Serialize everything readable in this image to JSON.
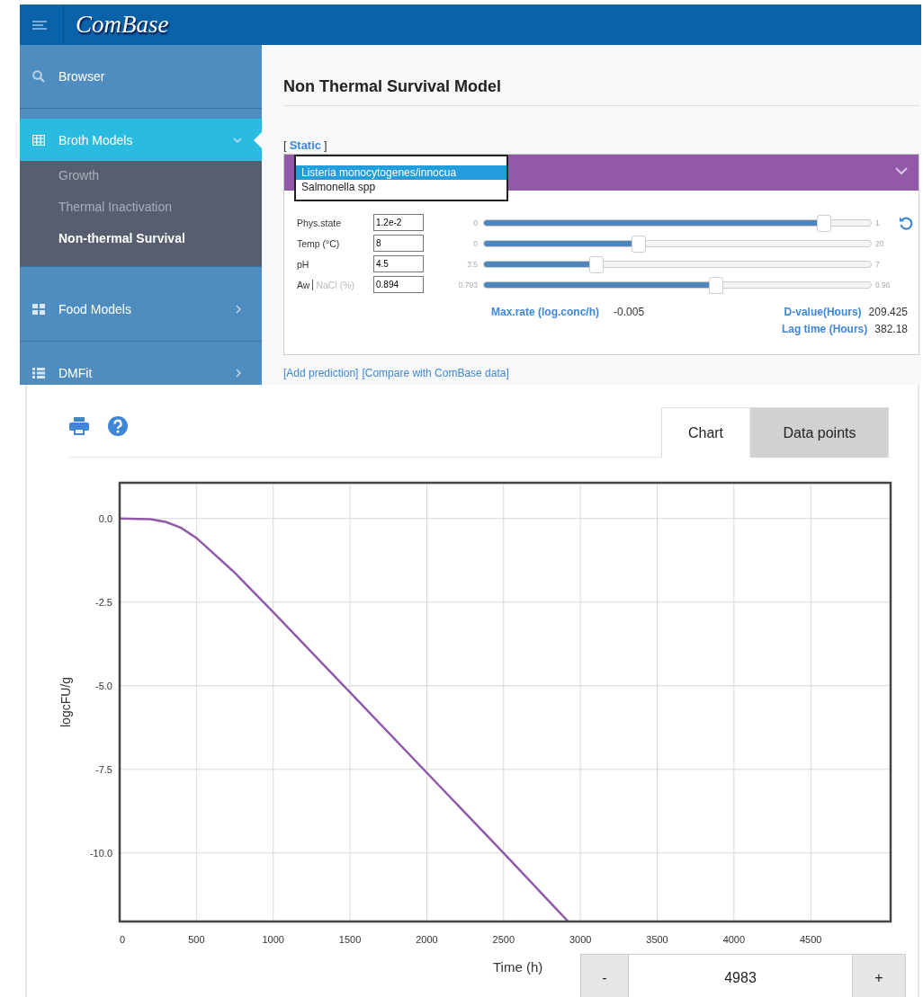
{
  "header": {
    "logo": "ComBase"
  },
  "sidebar": {
    "items": [
      {
        "label": "Browser",
        "selected": false
      },
      {
        "label": "Broth Models",
        "selected": true,
        "expanded": true,
        "children": [
          {
            "label": "Growth",
            "selected": false
          },
          {
            "label": "Thermal Inactivation",
            "selected": false
          },
          {
            "label": "Non-thermal Survival",
            "selected": true
          }
        ]
      },
      {
        "label": "Food Models",
        "selected": false,
        "expanded": false
      },
      {
        "label": "DMFit",
        "selected": false,
        "expanded": false
      }
    ]
  },
  "page_title": "Non Thermal Survival Model",
  "mode_link": {
    "open": "[",
    "label": "Static",
    "close": "]"
  },
  "organism_dropdown": {
    "options": [
      {
        "label": "Listeria monocytogenes/innocua",
        "selected": true
      },
      {
        "label": "Salmonella spp",
        "selected": false
      }
    ]
  },
  "parameters": [
    {
      "label": "Phys.state",
      "value": "1.2e-2",
      "min": "0",
      "max": "1",
      "level": 0.88
    },
    {
      "label": "Temp (°C)",
      "value": "8",
      "min": "0",
      "max": "20",
      "level": 0.4
    },
    {
      "label": "pH",
      "value": "4.5",
      "min": "3.5",
      "max": "7",
      "level": 0.29
    },
    {
      "label": "Aw",
      "alt_label": "NaCl (%)",
      "value": "0.894",
      "min": "0.793",
      "max": "0.96",
      "level": 0.6
    }
  ],
  "results": [
    {
      "label": "Max.rate (log.conc/h)",
      "value": "-0.005"
    },
    {
      "label": "D-value(Hours)",
      "value": "209.425"
    },
    {
      "label": "Lag time (Hours)",
      "value": "382.18"
    }
  ],
  "links": [
    "[Add prediction]",
    "[Compare with ComBase data]"
  ],
  "tabs": [
    {
      "label": "Chart",
      "selected": true
    },
    {
      "label": "Data points",
      "selected": false
    }
  ],
  "chart_data": {
    "type": "line",
    "grid": true,
    "xlabel": "Time (h)",
    "ylabel": "logcFU/g",
    "xlim": [
      0,
      5020
    ],
    "ylim": [
      -12.05,
      1.07
    ],
    "xticks": [
      0,
      500,
      1000,
      1500,
      2000,
      2500,
      3000,
      3500,
      4000,
      4500
    ],
    "yticks": [
      {
        "value": 0,
        "label": "0.0"
      },
      {
        "value": -2.5,
        "label": "-2.5"
      },
      {
        "value": -5,
        "label": "-5.0"
      },
      {
        "value": -7.5,
        "label": "-7.5"
      },
      {
        "value": -10,
        "label": "-10.0"
      }
    ],
    "x": [
      0,
      200,
      300,
      400,
      500,
      750,
      1000,
      1500,
      2000,
      2500,
      2920
    ],
    "series": [
      {
        "color": "#9159a8",
        "values": [
          0,
          -0.02,
          -0.1,
          -0.28,
          -0.58,
          -1.62,
          -2.8,
          -5.2,
          -7.6,
          -10.0,
          -12.05
        ]
      }
    ]
  },
  "time_stepper": {
    "decrement": "-",
    "value": "4983",
    "increment": "+"
  }
}
